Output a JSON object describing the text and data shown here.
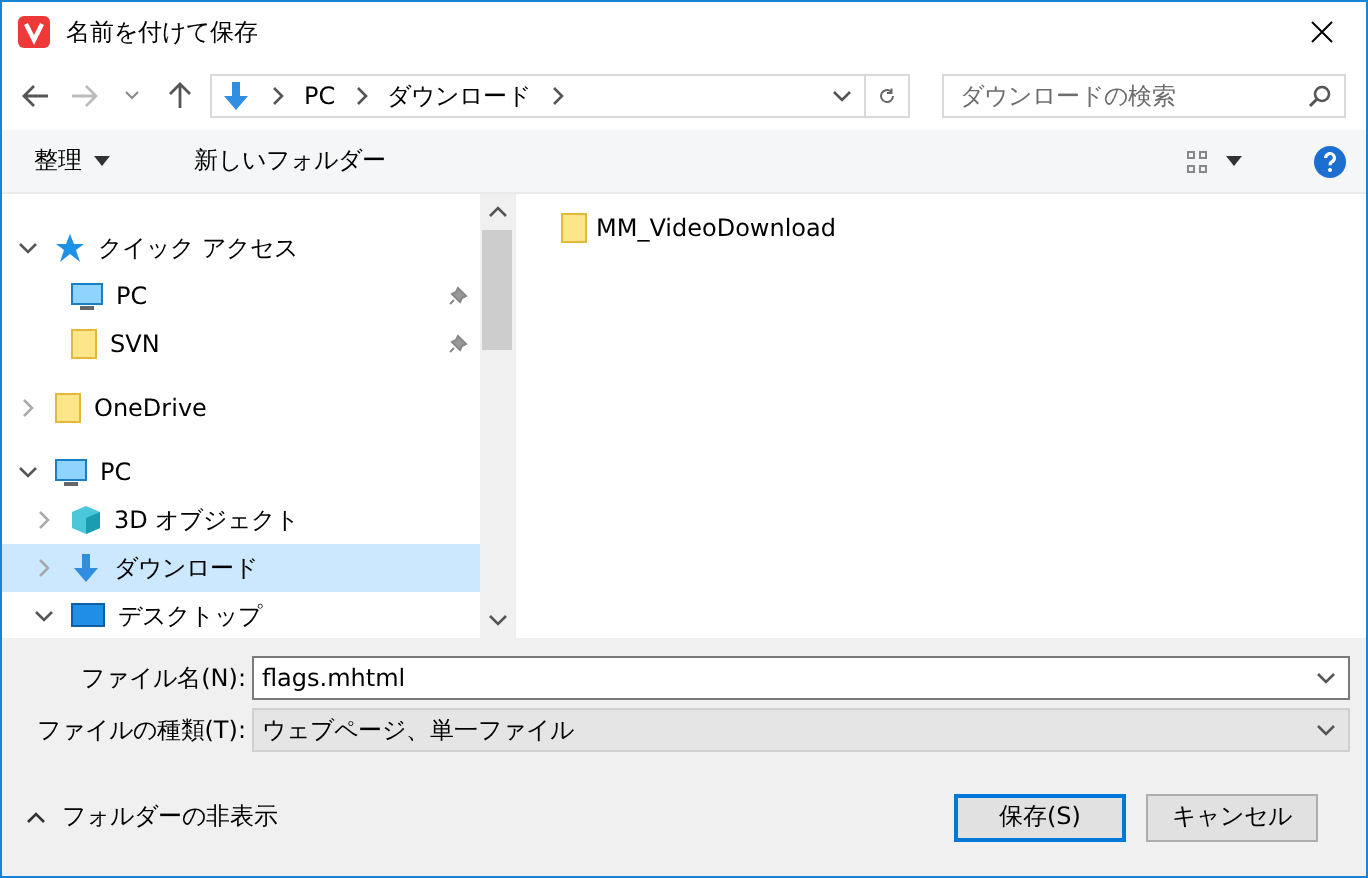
{
  "window": {
    "title": "名前を付けて保存"
  },
  "address": {
    "path": [
      "PC",
      "ダウンロード"
    ]
  },
  "search": {
    "placeholder": "ダウンロードの検索"
  },
  "toolbar": {
    "organize": "整理",
    "new_folder": "新しいフォルダー"
  },
  "tree": [
    {
      "label": "クイック アクセス",
      "kind": "star",
      "expanded": true,
      "selected": false,
      "children": [
        {
          "label": "PC",
          "kind": "pc",
          "pinned": true,
          "selected": false
        },
        {
          "label": "SVN",
          "kind": "folder",
          "pinned": true,
          "selected": false
        }
      ]
    },
    {
      "label": "OneDrive",
      "kind": "folder",
      "expanded": false,
      "selected": false
    },
    {
      "label": "PC",
      "kind": "pc",
      "expanded": true,
      "selected": false,
      "children": [
        {
          "label": "3D オブジェクト",
          "kind": "cube",
          "expanded": false,
          "selected": false
        },
        {
          "label": "ダウンロード",
          "kind": "download",
          "expanded": false,
          "selected": true
        },
        {
          "label": "デスクトップ",
          "kind": "desktop",
          "expanded": true,
          "selected": false
        }
      ]
    }
  ],
  "files": [
    {
      "name": "MM_VideoDownload",
      "kind": "folder"
    }
  ],
  "file_name": {
    "label": "ファイル名(N):",
    "value": "flags.mhtml"
  },
  "file_type": {
    "label": "ファイルの種類(T):",
    "value": "ウェブページ、単一ファイル"
  },
  "hide_folders": "フォルダーの非表示",
  "buttons": [
    {
      "label": "保存(S)",
      "primary": true
    },
    {
      "label": "キャンセル",
      "primary": false
    }
  ]
}
